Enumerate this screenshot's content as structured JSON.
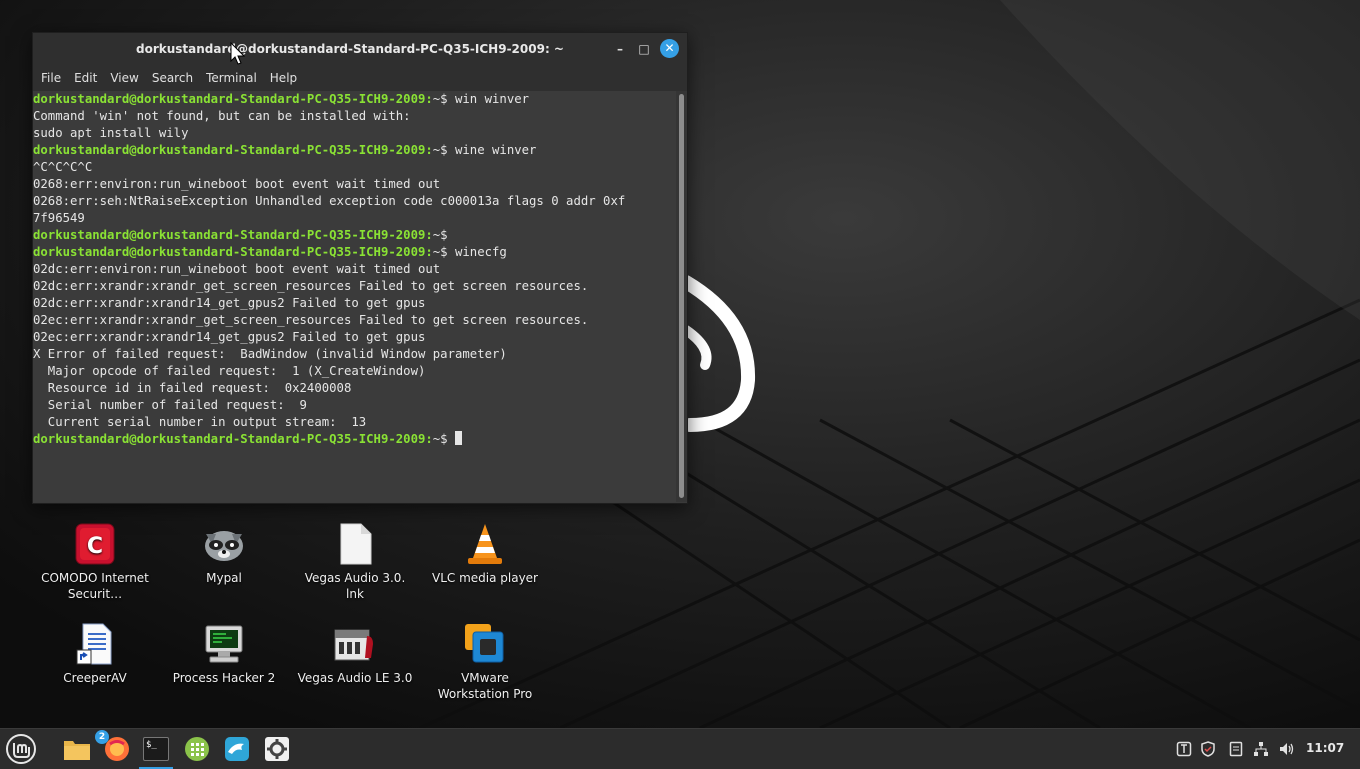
{
  "window": {
    "title": "dorkustandard@dorkustandard-Standard-PC-Q35-ICH9-2009: ~",
    "minimize_glyph": "–",
    "maximize_glyph": "□",
    "close_glyph": "✕"
  },
  "menu": [
    "File",
    "Edit",
    "View",
    "Search",
    "Terminal",
    "Help"
  ],
  "terminal": {
    "prompt": "dorkustandard@dorkustandard-Standard-PC-Q35-ICH9-2009:",
    "prompt_path": "~$",
    "lines": [
      {
        "type": "cmd",
        "text": " win winver"
      },
      {
        "type": "out",
        "text": "Command 'win' not found, but can be installed with:"
      },
      {
        "type": "out",
        "text": "sudo apt install wily"
      },
      {
        "type": "cmd",
        "text": " wine winver"
      },
      {
        "type": "out",
        "text": "^C^C^C^C"
      },
      {
        "type": "out",
        "text": "0268:err:environ:run_wineboot boot event wait timed out"
      },
      {
        "type": "out",
        "text": "0268:err:seh:NtRaiseException Unhandled exception code c000013a flags 0 addr 0xf"
      },
      {
        "type": "out",
        "text": "7f96549"
      },
      {
        "type": "cmd",
        "text": ""
      },
      {
        "type": "cmd",
        "text": " winecfg"
      },
      {
        "type": "out",
        "text": "02dc:err:environ:run_wineboot boot event wait timed out"
      },
      {
        "type": "out",
        "text": "02dc:err:xrandr:xrandr_get_screen_resources Failed to get screen resources."
      },
      {
        "type": "out",
        "text": "02dc:err:xrandr:xrandr14_get_gpus2 Failed to get gpus"
      },
      {
        "type": "out",
        "text": "02ec:err:xrandr:xrandr_get_screen_resources Failed to get screen resources."
      },
      {
        "type": "out",
        "text": "02ec:err:xrandr:xrandr14_get_gpus2 Failed to get gpus"
      },
      {
        "type": "out",
        "text": "X Error of failed request:  BadWindow (invalid Window parameter)"
      },
      {
        "type": "out",
        "text": "  Major opcode of failed request:  1 (X_CreateWindow)"
      },
      {
        "type": "out",
        "text": "  Resource id in failed request:  0x2400008"
      },
      {
        "type": "out",
        "text": "  Serial number of failed request:  9"
      },
      {
        "type": "out",
        "text": "  Current serial number in output stream:  13"
      },
      {
        "type": "current",
        "text": " "
      }
    ]
  },
  "desktop_icons": [
    {
      "name": "comodo",
      "label": "COMODO Internet Securit…",
      "icon": "comodo-icon"
    },
    {
      "name": "mypal",
      "label": "Mypal",
      "icon": "raccoon-icon"
    },
    {
      "name": "vegas-audio-lnk",
      "label": "Vegas Audio 3.0. lnk",
      "icon": "file-icon"
    },
    {
      "name": "vlc",
      "label": "VLC media player",
      "icon": "vlc-cone-icon"
    },
    {
      "name": "creeperav",
      "label": "CreeperAV",
      "icon": "document-shortcut-icon"
    },
    {
      "name": "process-hacker",
      "label": "Process Hacker 2",
      "icon": "computer-monitor-icon"
    },
    {
      "name": "vegas-audio-le",
      "label": "Vegas Audio LE 3.0",
      "icon": "audio-mixer-icon"
    },
    {
      "name": "vmware",
      "label": "VMware Workstation Pro",
      "icon": "vmware-icon"
    }
  ],
  "panel": {
    "firefox_badge": "2",
    "terminal_glyph": "$_",
    "clock": "11:07"
  },
  "colors": {
    "accent": "#35a0e6",
    "prompt": "#8ae234",
    "terminal_bg": "#3b3b3b"
  }
}
